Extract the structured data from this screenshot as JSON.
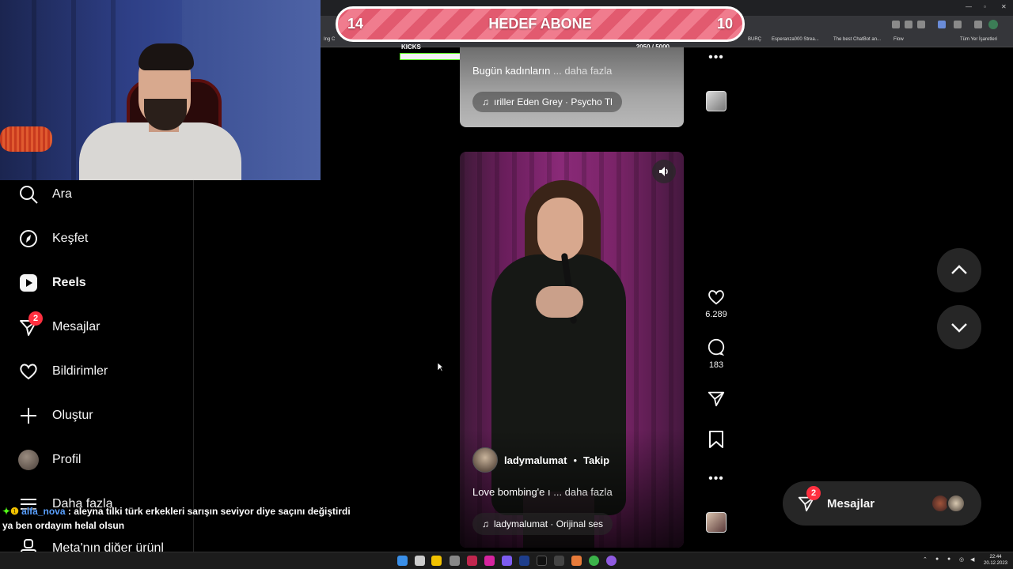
{
  "goal": {
    "left": "14",
    "title": "HEDEF ABONE",
    "right": "10"
  },
  "kicks": {
    "label": "KICKS",
    "current": "2050",
    "target": "/.5000",
    "progress": 0.41
  },
  "bookmarks": [
    "Esperanza000 Strea...",
    "The best ChatBot an...",
    "Flow",
    "Tüm Yer İşaretleri",
    "BURÇ",
    "Ing C"
  ],
  "sidebar": {
    "items": [
      {
        "label": "Ara",
        "icon": "search-icon"
      },
      {
        "label": "Keşfet",
        "icon": "compass-icon"
      },
      {
        "label": "Reels",
        "icon": "reels-icon"
      },
      {
        "label": "Mesajlar",
        "icon": "messenger-icon",
        "badge": "2"
      },
      {
        "label": "Bildirimler",
        "icon": "heart-icon"
      },
      {
        "label": "Oluştur",
        "icon": "plus-icon"
      },
      {
        "label": "Profil",
        "icon": "avatar"
      },
      {
        "label": "Daha fazla",
        "icon": "menu-icon"
      },
      {
        "label": "Meta'nın diğer ürünl",
        "icon": "meta-icon"
      }
    ]
  },
  "chat": {
    "user": "alfa_nova",
    "message": ": aleyna tilki türk erkekleri sarışın seviyor diye saçını değiştirdi ya ben ordayım helal olsun"
  },
  "reel_prev": {
    "caption": "Bugün kadınların",
    "more": "... daha fazla",
    "music": "ıriller  Eden Grey · Psycho Tl"
  },
  "reel": {
    "author": "ladymalumat",
    "dot": "•",
    "follow": "Takip",
    "caption": "Love bombing'e ı",
    "more": "... daha fazla",
    "music": "ladymalumat · Orijinal ses",
    "likes": "6.289",
    "comments": "183"
  },
  "messages": {
    "label": "Mesajlar",
    "badge": "2"
  },
  "clock": {
    "time": "22:44",
    "date": "20.12.2023"
  },
  "colors": {
    "goal": "#f07c8e",
    "badge": "#ff3040",
    "kicks": "#53fc18"
  }
}
